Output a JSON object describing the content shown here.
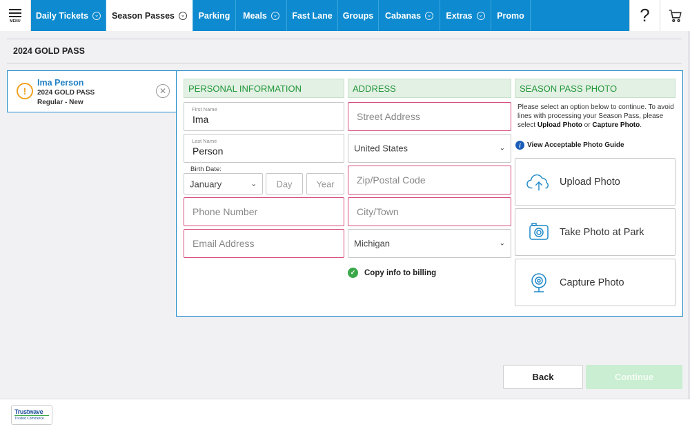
{
  "nav": {
    "menu_label": "MENU",
    "tabs": [
      {
        "label": "Daily Tickets",
        "has_dropdown": true,
        "active": false
      },
      {
        "label": "Season Passes",
        "has_dropdown": true,
        "active": true
      },
      {
        "label": "Parking",
        "has_dropdown": false,
        "active": false
      },
      {
        "label": "Meals",
        "has_dropdown": true,
        "active": false
      },
      {
        "label": "Fast Lane",
        "has_dropdown": false,
        "active": false
      },
      {
        "label": "Groups",
        "has_dropdown": false,
        "active": false
      },
      {
        "label": "Cabanas",
        "has_dropdown": true,
        "active": false
      },
      {
        "label": "Extras",
        "has_dropdown": true,
        "active": false
      },
      {
        "label": "Promo",
        "has_dropdown": false,
        "active": false
      }
    ],
    "help_label": "?",
    "accent_color": "#0e8bd0"
  },
  "page_title": "2024 GOLD PASS",
  "guest": {
    "name": "Ima Person",
    "pass": "2024 GOLD PASS",
    "type": "Regular - New"
  },
  "personal": {
    "heading": "PERSONAL INFORMATION",
    "first_name_label": "First Name",
    "first_name": "Ima",
    "last_name_label": "Last Name",
    "last_name": "Person",
    "birth_label": "Birth Date:",
    "birth_month": "January",
    "day_placeholder": "Day",
    "year_placeholder": "Year",
    "phone_placeholder": "Phone Number",
    "email_placeholder": "Email Address"
  },
  "address": {
    "heading": "ADDRESS",
    "street_placeholder": "Street Address",
    "country": "United States",
    "zip_placeholder": "Zip/Postal Code",
    "city_placeholder": "City/Town",
    "state": "Michigan",
    "copy_label": "Copy info to billing"
  },
  "photo": {
    "heading": "SEASON PASS PHOTO",
    "desc_part1": "Please select an option below to continue. To avoid lines with processing your Season Pass, please select ",
    "desc_bold1": "Upload Photo",
    "desc_or": " or ",
    "desc_bold2": "Capture Photo",
    "desc_end": ".",
    "guide_label": "View Acceptable Photo Guide",
    "options": [
      {
        "label": "Upload Photo",
        "icon": "cloud-upload-icon"
      },
      {
        "label": "Take Photo at Park",
        "icon": "camera-icon"
      },
      {
        "label": "Capture Photo",
        "icon": "webcam-icon"
      }
    ]
  },
  "buttons": {
    "back": "Back",
    "continue": "Continue"
  },
  "footer": {
    "trust_name": "Trustwave",
    "trust_sub": "Trusted Commerce"
  },
  "colors": {
    "required_border": "#d64a7a",
    "section_heading": "#22973a",
    "link_blue": "#1e7fc4"
  }
}
